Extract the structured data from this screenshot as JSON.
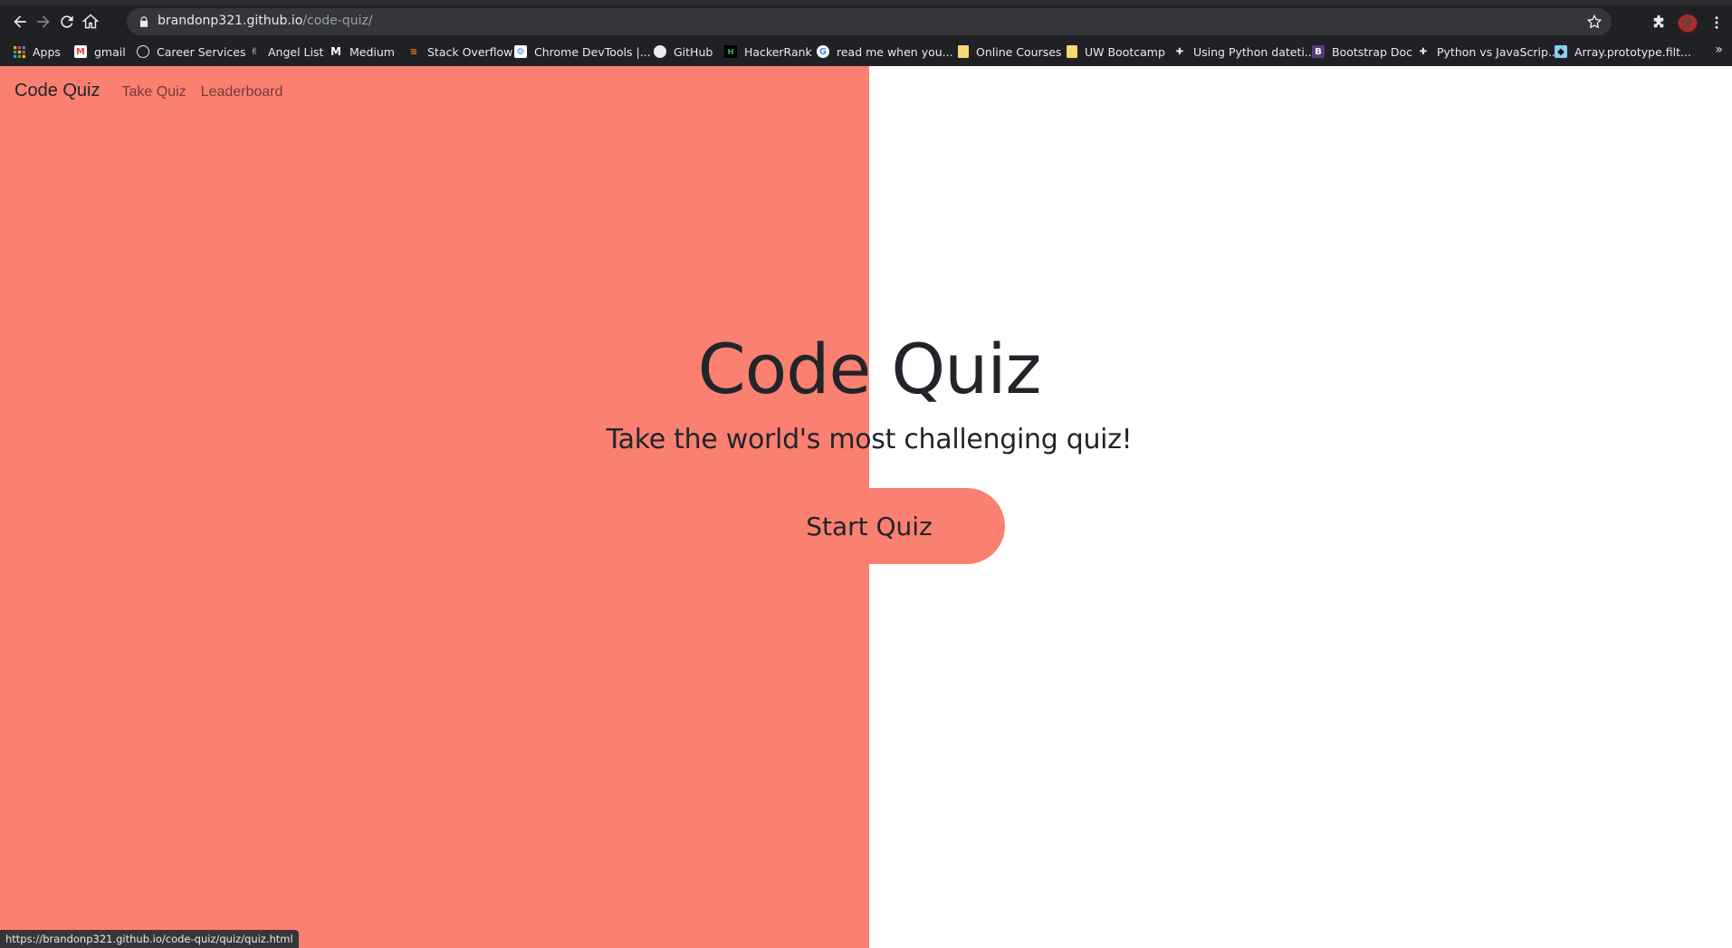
{
  "browser": {
    "url_host": "brandonp321.github.io",
    "url_path": "/code-quiz/",
    "bookmarks": [
      {
        "label": "Apps",
        "icon": "apps-grid-icon"
      },
      {
        "label": "gmail",
        "icon": "gmail-icon"
      },
      {
        "label": "Career Services",
        "icon": "globe-icon"
      },
      {
        "label": "Angel List",
        "icon": "angellist-icon"
      },
      {
        "label": "Medium",
        "icon": "medium-icon"
      },
      {
        "label": "Stack Overflow",
        "icon": "stackoverflow-icon"
      },
      {
        "label": "Chrome DevTools |...",
        "icon": "devtools-icon"
      },
      {
        "label": "GitHub",
        "icon": "github-icon"
      },
      {
        "label": "HackerRank",
        "icon": "hackerrank-icon"
      },
      {
        "label": "read me when you...",
        "icon": "google-icon"
      },
      {
        "label": "Online Courses",
        "icon": "folder-icon"
      },
      {
        "label": "UW Bootcamp",
        "icon": "folder-icon"
      },
      {
        "label": "Using Python dateti...",
        "icon": "puzzle-icon"
      },
      {
        "label": "Bootstrap Doc",
        "icon": "bootstrap-icon"
      },
      {
        "label": "Python vs JavaScrip...",
        "icon": "puzzle-icon"
      },
      {
        "label": "Array.prototype.filt...",
        "icon": "mdn-icon"
      }
    ],
    "status_url": "https://brandonp321.github.io/code-quiz/quiz/quiz.html"
  },
  "nav": {
    "brand": "Code Quiz",
    "links": [
      "Take Quiz",
      "Leaderboard"
    ]
  },
  "hero": {
    "title": "Code Quiz",
    "subtitle": "Take the world's most challenging quiz!",
    "button_label": "Start Quiz"
  },
  "colors": {
    "accent": "#fa8072",
    "text": "#212529"
  }
}
